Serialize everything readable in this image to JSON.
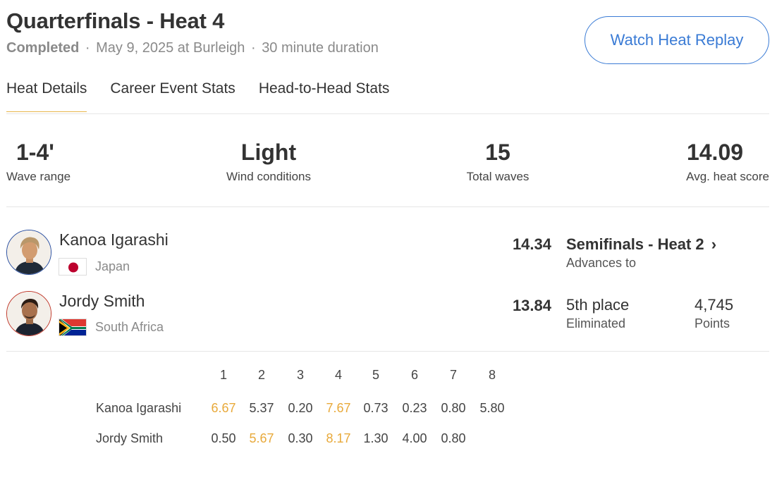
{
  "header": {
    "title": "Quarterfinals - Heat 4",
    "status": "Completed",
    "date_location": "May 9, 2025 at Burleigh",
    "duration": "30 minute duration",
    "separator": "·",
    "replay_label": "Watch Heat Replay"
  },
  "tabs": [
    {
      "label": "Heat Details",
      "active": true
    },
    {
      "label": "Career Event Stats",
      "active": false
    },
    {
      "label": "Head-to-Head Stats",
      "active": false
    }
  ],
  "stats": [
    {
      "value": "1-4'",
      "label": "Wave range"
    },
    {
      "value": "Light",
      "label": "Wind conditions"
    },
    {
      "value": "15",
      "label": "Total waves"
    },
    {
      "value": "14.09",
      "label": "Avg. heat score"
    }
  ],
  "surfers": [
    {
      "name": "Kanoa Igarashi",
      "country": "Japan",
      "score": "14.34",
      "result_link": "Semifinals - Heat 2",
      "result_sub": "Advances to",
      "chevron": "›"
    },
    {
      "name": "Jordy Smith",
      "country": "South Africa",
      "score": "13.84",
      "result_place": "5th place",
      "result_sub": "Eliminated",
      "points": "4,745",
      "points_label": "Points"
    }
  ],
  "wave_table": {
    "headers": [
      "1",
      "2",
      "3",
      "4",
      "5",
      "6",
      "7",
      "8"
    ],
    "rows": [
      {
        "name": "Kanoa Igarashi",
        "scores": [
          "6.67",
          "5.37",
          "0.20",
          "7.67",
          "0.73",
          "0.23",
          "0.80",
          "5.80"
        ],
        "counted": [
          0,
          3
        ]
      },
      {
        "name": "Jordy Smith",
        "scores": [
          "0.50",
          "5.67",
          "0.30",
          "8.17",
          "1.30",
          "4.00",
          "0.80"
        ],
        "counted": [
          1,
          3
        ]
      }
    ]
  },
  "colors": {
    "accent_blue": "#3a7bd5",
    "tab_underline": "#e8b64c",
    "counted_wave": "#e8a93a",
    "text": "#333333",
    "muted": "#8a8a8a"
  },
  "icons": {
    "chevron": "chevron-right-icon",
    "avatar": "surfer-avatar",
    "flag": "country-flag"
  }
}
